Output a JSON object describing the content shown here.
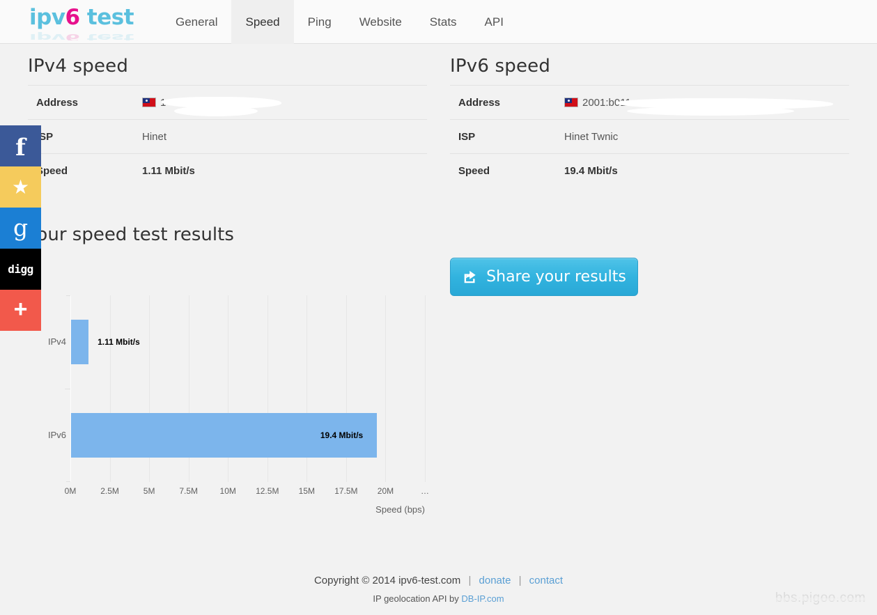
{
  "header": {
    "logo": {
      "part1": "ipv",
      "part2": "6",
      "part3": " test"
    },
    "nav": [
      {
        "label": "General",
        "active": false
      },
      {
        "label": "Speed",
        "active": true
      },
      {
        "label": "Ping",
        "active": false
      },
      {
        "label": "Website",
        "active": false
      },
      {
        "label": "Stats",
        "active": false
      },
      {
        "label": "API",
        "active": false
      }
    ]
  },
  "ipv4_panel": {
    "title": "IPv4 speed",
    "rows": [
      {
        "key": "Address",
        "value": "1"
      },
      {
        "key": "ISP",
        "value": "Hinet"
      },
      {
        "key": "Speed",
        "value": "1.11 Mbit/s"
      }
    ]
  },
  "ipv6_panel": {
    "title": "IPv6 speed",
    "rows": [
      {
        "key": "Address",
        "value": "2001:b011:"
      },
      {
        "key": "ISP",
        "value": "Hinet Twnic"
      },
      {
        "key": "Speed",
        "value": "19.4 Mbit/s"
      }
    ]
  },
  "chart_data": {
    "type": "bar",
    "orientation": "horizontal",
    "title": "Your speed test results",
    "categories": [
      "IPv4",
      "IPv6"
    ],
    "values": [
      1110000,
      19400000
    ],
    "data_labels": [
      "1.11 Mbit/s",
      "19.4 Mbit/s"
    ],
    "xlabel": "Speed (bps)",
    "ylabel": "",
    "xlim": [
      0,
      22500000
    ],
    "tick_labels": [
      "0M",
      "2.5M",
      "5M",
      "7.5M",
      "10M",
      "12.5M",
      "15M",
      "17.5M",
      "20M",
      "…"
    ],
    "tick_values": [
      0,
      2500000,
      5000000,
      7500000,
      10000000,
      12500000,
      15000000,
      17500000,
      20000000,
      22500000
    ],
    "grid": true,
    "legend": false,
    "bar_color": "#7cb5ec"
  },
  "share_button": {
    "label": "Share your results",
    "icon": "share-icon"
  },
  "social": [
    {
      "name": "facebook",
      "glyph": "f",
      "color": "#3b5998"
    },
    {
      "name": "favorite",
      "glyph": "★",
      "color": "#f5cb5c"
    },
    {
      "name": "google",
      "glyph": "g",
      "color": "#1b7fd4"
    },
    {
      "name": "digg",
      "glyph": "digg",
      "color": "#000000"
    },
    {
      "name": "more",
      "glyph": "+",
      "color": "#f2594b"
    }
  ],
  "footer": {
    "copyright": "Copyright © 2014 ipv6-test.com",
    "donate": "donate",
    "contact": "contact",
    "separator": "|",
    "geo_prefix": "IP geolocation API by ",
    "geo_link": "DB-IP.com"
  },
  "watermark": "bbs.pigoo.com"
}
